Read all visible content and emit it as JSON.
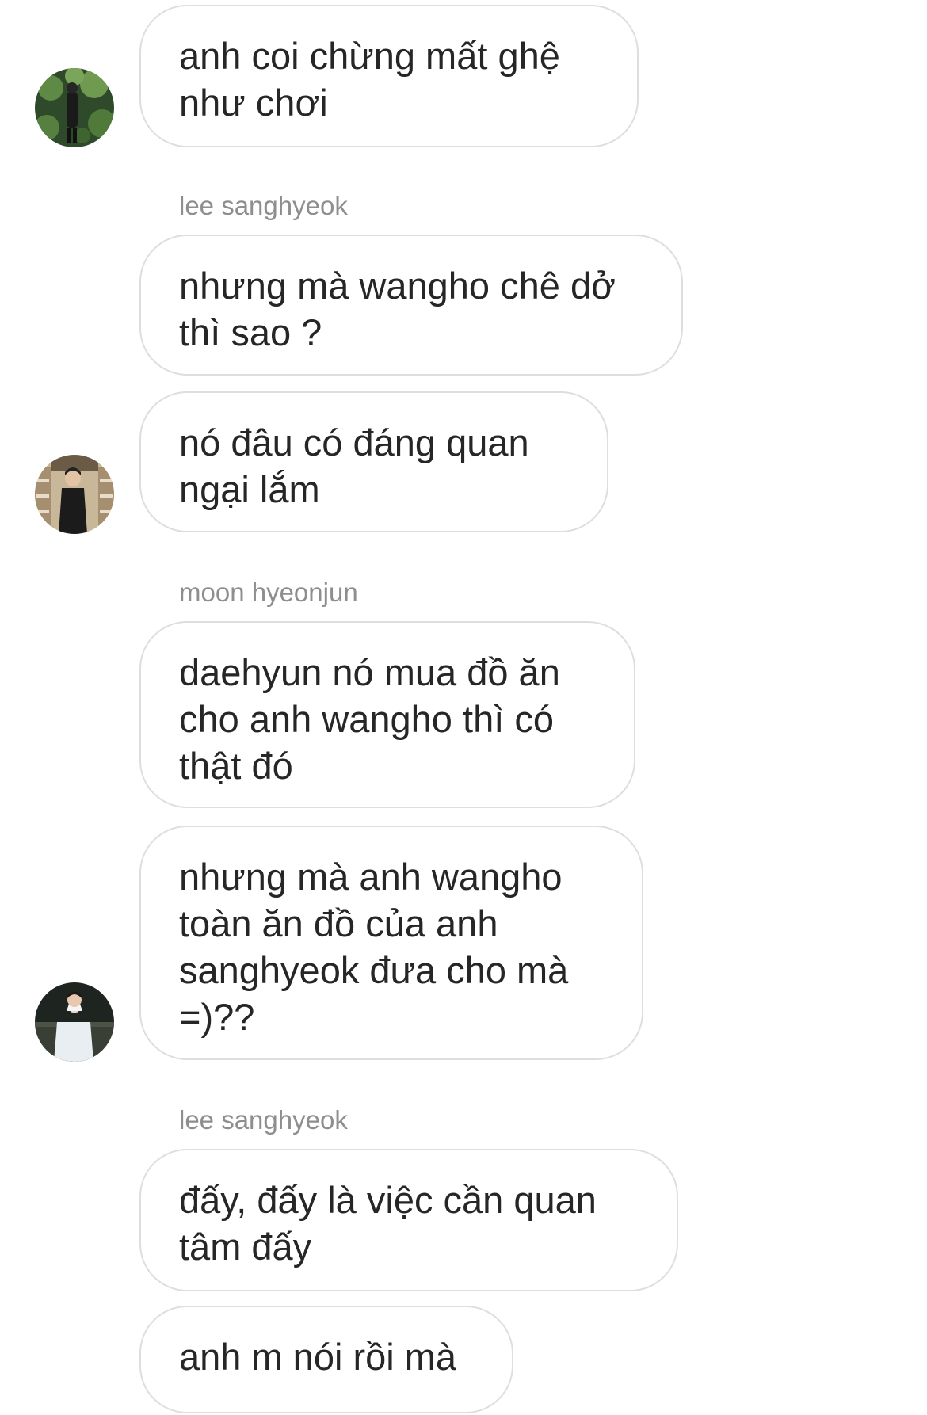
{
  "chat": {
    "avatar_alts": [
      "Profile picture",
      "Profile picture",
      "Profile picture"
    ],
    "items": [
      {
        "type": "message",
        "text": "anh coi chừng mất ghệ\nnhư chơi"
      },
      {
        "type": "sender",
        "text": "lee sanghyeok"
      },
      {
        "type": "message",
        "text": "nhưng mà wangho chê dở\nthì sao ?"
      },
      {
        "type": "message",
        "text": "nó đâu có đáng quan\nngại lắm"
      },
      {
        "type": "sender",
        "text": "moon hyeonjun"
      },
      {
        "type": "message",
        "text": "daehyun nó mua đồ ăn\ncho anh wangho thì có\nthật đó"
      },
      {
        "type": "message",
        "text": "nhưng mà anh wangho\ntoàn ăn đồ của anh\nsanghyeok đưa cho mà\n=)??"
      },
      {
        "type": "sender",
        "text": "lee sanghyeok"
      },
      {
        "type": "message",
        "text": "đấy, đấy là việc cần quan\ntâm đấy"
      },
      {
        "type": "message",
        "text": "anh m nói rồi mà"
      }
    ]
  }
}
